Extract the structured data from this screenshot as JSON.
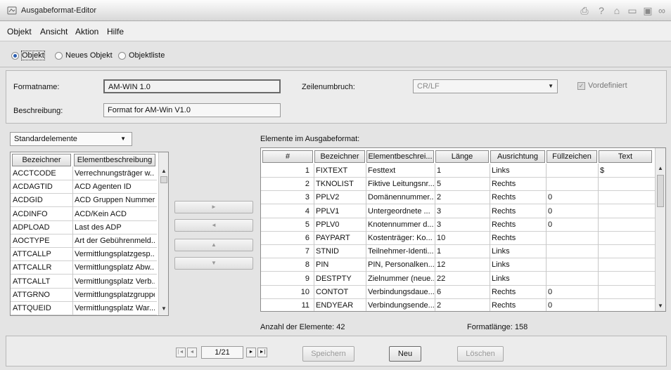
{
  "window": {
    "title": "Ausgabeformat-Editor"
  },
  "titlebar_icons": [
    "printer-icon",
    "help-icon",
    "home-icon",
    "folder-icon",
    "save-icon",
    "link-icon"
  ],
  "menu": [
    "Objekt",
    "Ansicht",
    "Aktion",
    "Hilfe"
  ],
  "mode": {
    "options": [
      "Objekt",
      "Neues Objekt",
      "Objektliste"
    ],
    "selected": "Objekt"
  },
  "form": {
    "formatname_label": "Formatname:",
    "formatname_value": "AM-WIN 1.0",
    "beschreibung_label": "Beschreibung:",
    "beschreibung_value": "Format for AM-Win V1.0",
    "zeilenumbruch_label": "Zeilenumbruch:",
    "zeilenumbruch_value": "CR/LF",
    "vordefiniert_label": "Vordefiniert",
    "vordefiniert_checked": true
  },
  "left": {
    "combo_value": "Standardelemente",
    "columns": [
      "Bezeichner",
      "Elementbeschreibung"
    ],
    "rows": [
      [
        "ACCTCODE",
        "Verrechnungsträger w..."
      ],
      [
        "ACDAGTID",
        "ACD Agenten ID"
      ],
      [
        "ACDGID",
        "ACD Gruppen Nummer"
      ],
      [
        "ACDINFO",
        "ACD/Kein ACD"
      ],
      [
        "ADPLOAD",
        "Last des ADP"
      ],
      [
        "AOCTYPE",
        "Art der Gebührenmeld..."
      ],
      [
        "ATTCALLP",
        "Vermittlungsplatzgesp..."
      ],
      [
        "ATTCALLR",
        "Vermittlungsplatz Abw..."
      ],
      [
        "ATTCALLT",
        "Vermittlungsplatz Verb..."
      ],
      [
        "ATTGRNO",
        "Vermittlungsplatzgruppe"
      ],
      [
        "ATTQUEID",
        "Vermittlungsplatz War..."
      ]
    ]
  },
  "right": {
    "caption": "Elemente im Ausgabeformat:",
    "columns": [
      "#",
      "Bezeichner",
      "Elementbeschrei...",
      "Länge",
      "Ausrichtung",
      "Füllzeichen",
      "Text"
    ],
    "rows": [
      [
        "1",
        "FIXTEXT",
        "Festtext",
        "1",
        "Links",
        "",
        "$"
      ],
      [
        "2",
        "TKNOLIST",
        "Fiktive Leitungsnr...",
        "5",
        "Rechts",
        "",
        ""
      ],
      [
        "3",
        "PPLV2",
        "Domänennummer...",
        "2",
        "Rechts",
        "0",
        ""
      ],
      [
        "4",
        "PPLV1",
        "Untergeordnete ...",
        "3",
        "Rechts",
        "0",
        ""
      ],
      [
        "5",
        "PPLV0",
        "Knotennummer d...",
        "3",
        "Rechts",
        "0",
        ""
      ],
      [
        "6",
        "PAYPART",
        "Kostenträger: Ko...",
        "10",
        "Rechts",
        "",
        ""
      ],
      [
        "7",
        "STNID",
        "Teilnehmer-Identi...",
        "1",
        "Links",
        "",
        ""
      ],
      [
        "8",
        "PIN",
        "PIN, Personalken...",
        "12",
        "Links",
        "",
        ""
      ],
      [
        "9",
        "DESTPTY",
        "Zielnummer (neue...",
        "22",
        "Links",
        "",
        ""
      ],
      [
        "10",
        "CONTOT",
        "Verbindungsdaue...",
        "6",
        "Rechts",
        "0",
        ""
      ],
      [
        "11",
        "ENDYEAR",
        "Verbindungsende...",
        "2",
        "Rechts",
        "0",
        ""
      ]
    ]
  },
  "footer": {
    "anzahl": "Anzahl der Elemente: 42",
    "formatlaenge": "Formatlänge: 158"
  },
  "nav": {
    "page": "1/21",
    "save": "Speichern",
    "new": "Neu",
    "delete": "Löschen"
  }
}
